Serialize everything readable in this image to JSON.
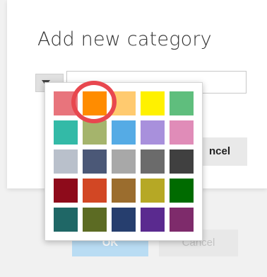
{
  "dialog": {
    "title": "Add new category",
    "name_input": {
      "value": "",
      "placeholder": ""
    },
    "inner_cancel_label": "ncel"
  },
  "background_buttons": {
    "ok_label": "OK",
    "cancel_label": "Cancel"
  },
  "palette": {
    "selected_index": 1,
    "highlight_color": "#e8474f",
    "swatches": [
      {
        "name": "swatch-light-red",
        "color": "#e8747c"
      },
      {
        "name": "swatch-orange",
        "color": "#ff8c00"
      },
      {
        "name": "swatch-light-orange",
        "color": "#ffca6f"
      },
      {
        "name": "swatch-yellow",
        "color": "#fff100"
      },
      {
        "name": "swatch-green",
        "color": "#5fbe7d"
      },
      {
        "name": "swatch-teal",
        "color": "#33baa7"
      },
      {
        "name": "swatch-olive",
        "color": "#a5b46c"
      },
      {
        "name": "swatch-blue",
        "color": "#55abe5"
      },
      {
        "name": "swatch-purple",
        "color": "#a890dc"
      },
      {
        "name": "swatch-pink",
        "color": "#e08cb8"
      },
      {
        "name": "swatch-light-gray",
        "color": "#b9c0cb"
      },
      {
        "name": "swatch-slate",
        "color": "#4b5877"
      },
      {
        "name": "swatch-gray",
        "color": "#a8a8a8"
      },
      {
        "name": "swatch-dark-gray",
        "color": "#6b6b6b"
      },
      {
        "name": "swatch-charcoal",
        "color": "#404040"
      },
      {
        "name": "swatch-dark-red",
        "color": "#8e0b1b"
      },
      {
        "name": "swatch-burnt-orange",
        "color": "#d24724"
      },
      {
        "name": "swatch-brown",
        "color": "#9b6d2e"
      },
      {
        "name": "swatch-mustard",
        "color": "#b6a825"
      },
      {
        "name": "swatch-dark-green",
        "color": "#006b00"
      },
      {
        "name": "swatch-dark-teal",
        "color": "#1f6766"
      },
      {
        "name": "swatch-dark-olive",
        "color": "#5c6b23"
      },
      {
        "name": "swatch-navy",
        "color": "#263e6e"
      },
      {
        "name": "swatch-dark-purple",
        "color": "#5a2a8f"
      },
      {
        "name": "swatch-plum",
        "color": "#7e2b6b"
      }
    ]
  }
}
